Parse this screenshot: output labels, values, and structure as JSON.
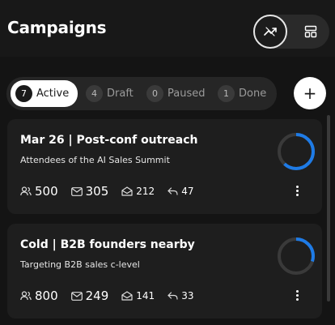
{
  "header": {
    "title": "Campaigns",
    "view_toggle": {
      "analytics_icon": "trend-chart-icon",
      "layout_icon": "layout-grid-icon"
    }
  },
  "filters": [
    {
      "count": "7",
      "label": "Active"
    },
    {
      "count": "4",
      "label": "Draft"
    },
    {
      "count": "0",
      "label": "Paused"
    },
    {
      "count": "1",
      "label": "Done"
    }
  ],
  "add_button": {
    "label": "+"
  },
  "campaigns": [
    {
      "title": "Mar 26 | Post-conf outreach",
      "subtitle": "Attendees of the AI Sales Summit",
      "progress": 0.62,
      "stats": {
        "leads": "500",
        "sent": "305",
        "opened": "212",
        "replied": "47"
      }
    },
    {
      "title": "Cold | B2B founders nearby",
      "subtitle": "Targeting B2B sales c-level",
      "progress": 0.3,
      "stats": {
        "leads": "800",
        "sent": "249",
        "opened": "141",
        "replied": "33"
      }
    }
  ],
  "colors": {
    "accent": "#1e7be6",
    "ring_track": "#3a3a3a",
    "background": "#141414",
    "card": "#1e1e1e"
  }
}
